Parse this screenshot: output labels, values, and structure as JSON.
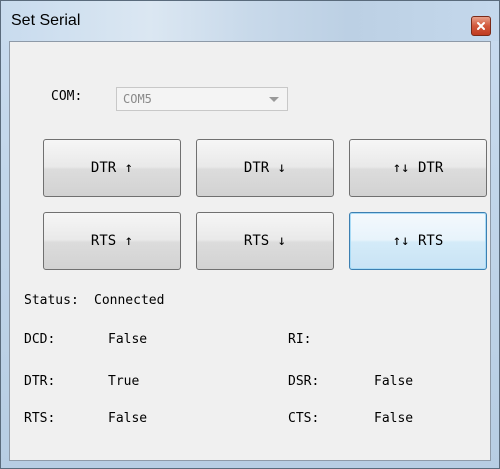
{
  "window": {
    "title": "Set Serial",
    "close_icon": "close-icon"
  },
  "com": {
    "label": "COM:",
    "selected": "COM5"
  },
  "buttons": {
    "dtr_up": "DTR ↑",
    "dtr_down": "DTR ↓",
    "dtr_toggle": "↑↓ DTR",
    "rts_up": "RTS ↑",
    "rts_down": "RTS ↓",
    "rts_toggle": "↑↓ RTS"
  },
  "status": {
    "label": "Status:",
    "value": "Connected"
  },
  "signals": {
    "dcd": {
      "label": "DCD:",
      "value": "False"
    },
    "ri": {
      "label": "RI:",
      "value": ""
    },
    "dtr": {
      "label": "DTR:",
      "value": "True"
    },
    "dsr": {
      "label": "DSR:",
      "value": "False"
    },
    "rts": {
      "label": "RTS:",
      "value": "False"
    },
    "cts": {
      "label": "CTS:",
      "value": "False"
    }
  },
  "colors": {
    "titlebar": "#c8dbee",
    "close_button": "#c03b20",
    "client_bg": "#f0f0f0",
    "focus_border": "#3c7fb1"
  }
}
